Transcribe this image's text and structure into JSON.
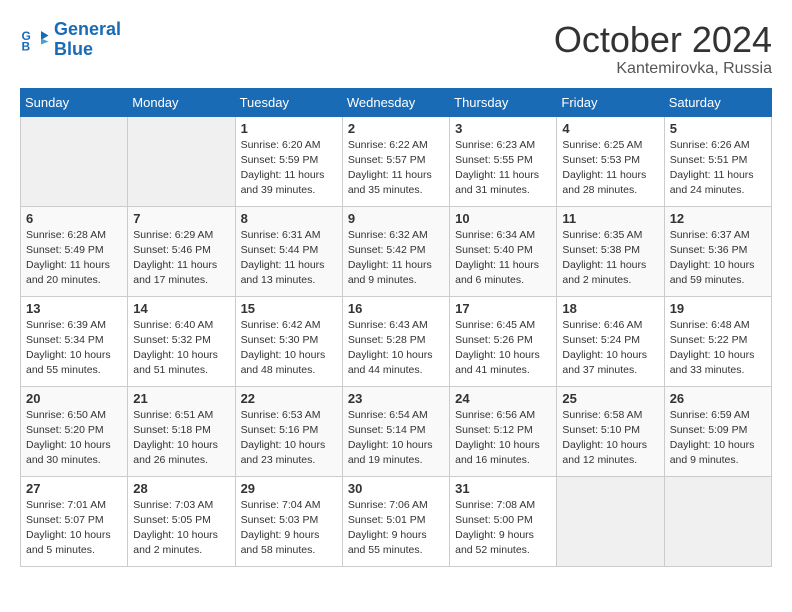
{
  "header": {
    "logo_line1": "General",
    "logo_line2": "Blue",
    "month": "October 2024",
    "location": "Kantemirovka, Russia"
  },
  "weekdays": [
    "Sunday",
    "Monday",
    "Tuesday",
    "Wednesday",
    "Thursday",
    "Friday",
    "Saturday"
  ],
  "weeks": [
    [
      {
        "day": "",
        "info": ""
      },
      {
        "day": "",
        "info": ""
      },
      {
        "day": "1",
        "info": "Sunrise: 6:20 AM\nSunset: 5:59 PM\nDaylight: 11 hours\nand 39 minutes."
      },
      {
        "day": "2",
        "info": "Sunrise: 6:22 AM\nSunset: 5:57 PM\nDaylight: 11 hours\nand 35 minutes."
      },
      {
        "day": "3",
        "info": "Sunrise: 6:23 AM\nSunset: 5:55 PM\nDaylight: 11 hours\nand 31 minutes."
      },
      {
        "day": "4",
        "info": "Sunrise: 6:25 AM\nSunset: 5:53 PM\nDaylight: 11 hours\nand 28 minutes."
      },
      {
        "day": "5",
        "info": "Sunrise: 6:26 AM\nSunset: 5:51 PM\nDaylight: 11 hours\nand 24 minutes."
      }
    ],
    [
      {
        "day": "6",
        "info": "Sunrise: 6:28 AM\nSunset: 5:49 PM\nDaylight: 11 hours\nand 20 minutes."
      },
      {
        "day": "7",
        "info": "Sunrise: 6:29 AM\nSunset: 5:46 PM\nDaylight: 11 hours\nand 17 minutes."
      },
      {
        "day": "8",
        "info": "Sunrise: 6:31 AM\nSunset: 5:44 PM\nDaylight: 11 hours\nand 13 minutes."
      },
      {
        "day": "9",
        "info": "Sunrise: 6:32 AM\nSunset: 5:42 PM\nDaylight: 11 hours\nand 9 minutes."
      },
      {
        "day": "10",
        "info": "Sunrise: 6:34 AM\nSunset: 5:40 PM\nDaylight: 11 hours\nand 6 minutes."
      },
      {
        "day": "11",
        "info": "Sunrise: 6:35 AM\nSunset: 5:38 PM\nDaylight: 11 hours\nand 2 minutes."
      },
      {
        "day": "12",
        "info": "Sunrise: 6:37 AM\nSunset: 5:36 PM\nDaylight: 10 hours\nand 59 minutes."
      }
    ],
    [
      {
        "day": "13",
        "info": "Sunrise: 6:39 AM\nSunset: 5:34 PM\nDaylight: 10 hours\nand 55 minutes."
      },
      {
        "day": "14",
        "info": "Sunrise: 6:40 AM\nSunset: 5:32 PM\nDaylight: 10 hours\nand 51 minutes."
      },
      {
        "day": "15",
        "info": "Sunrise: 6:42 AM\nSunset: 5:30 PM\nDaylight: 10 hours\nand 48 minutes."
      },
      {
        "day": "16",
        "info": "Sunrise: 6:43 AM\nSunset: 5:28 PM\nDaylight: 10 hours\nand 44 minutes."
      },
      {
        "day": "17",
        "info": "Sunrise: 6:45 AM\nSunset: 5:26 PM\nDaylight: 10 hours\nand 41 minutes."
      },
      {
        "day": "18",
        "info": "Sunrise: 6:46 AM\nSunset: 5:24 PM\nDaylight: 10 hours\nand 37 minutes."
      },
      {
        "day": "19",
        "info": "Sunrise: 6:48 AM\nSunset: 5:22 PM\nDaylight: 10 hours\nand 33 minutes."
      }
    ],
    [
      {
        "day": "20",
        "info": "Sunrise: 6:50 AM\nSunset: 5:20 PM\nDaylight: 10 hours\nand 30 minutes."
      },
      {
        "day": "21",
        "info": "Sunrise: 6:51 AM\nSunset: 5:18 PM\nDaylight: 10 hours\nand 26 minutes."
      },
      {
        "day": "22",
        "info": "Sunrise: 6:53 AM\nSunset: 5:16 PM\nDaylight: 10 hours\nand 23 minutes."
      },
      {
        "day": "23",
        "info": "Sunrise: 6:54 AM\nSunset: 5:14 PM\nDaylight: 10 hours\nand 19 minutes."
      },
      {
        "day": "24",
        "info": "Sunrise: 6:56 AM\nSunset: 5:12 PM\nDaylight: 10 hours\nand 16 minutes."
      },
      {
        "day": "25",
        "info": "Sunrise: 6:58 AM\nSunset: 5:10 PM\nDaylight: 10 hours\nand 12 minutes."
      },
      {
        "day": "26",
        "info": "Sunrise: 6:59 AM\nSunset: 5:09 PM\nDaylight: 10 hours\nand 9 minutes."
      }
    ],
    [
      {
        "day": "27",
        "info": "Sunrise: 7:01 AM\nSunset: 5:07 PM\nDaylight: 10 hours\nand 5 minutes."
      },
      {
        "day": "28",
        "info": "Sunrise: 7:03 AM\nSunset: 5:05 PM\nDaylight: 10 hours\nand 2 minutes."
      },
      {
        "day": "29",
        "info": "Sunrise: 7:04 AM\nSunset: 5:03 PM\nDaylight: 9 hours\nand 58 minutes."
      },
      {
        "day": "30",
        "info": "Sunrise: 7:06 AM\nSunset: 5:01 PM\nDaylight: 9 hours\nand 55 minutes."
      },
      {
        "day": "31",
        "info": "Sunrise: 7:08 AM\nSunset: 5:00 PM\nDaylight: 9 hours\nand 52 minutes."
      },
      {
        "day": "",
        "info": ""
      },
      {
        "day": "",
        "info": ""
      }
    ]
  ]
}
